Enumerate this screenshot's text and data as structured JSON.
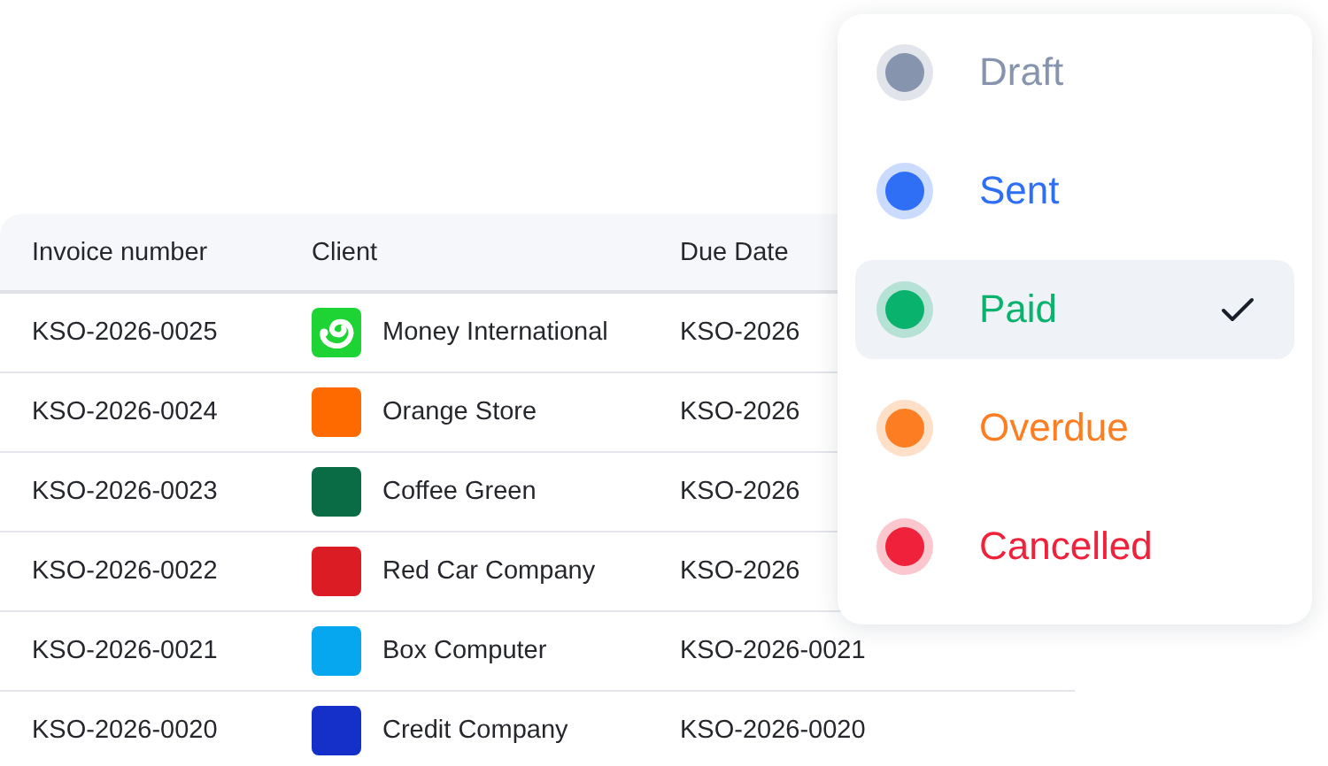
{
  "table": {
    "columns": [
      "Invoice number",
      "Client",
      "Due Date"
    ],
    "rows": [
      {
        "invoice": "KSO-2026-0025",
        "client": "Money International",
        "kind": "logo",
        "color": "#1ed334",
        "due": "KSO-2026"
      },
      {
        "invoice": "KSO-2026-0024",
        "client": "Orange Store",
        "kind": "swatch",
        "color": "#ff6a00",
        "due": "KSO-2026"
      },
      {
        "invoice": "KSO-2026-0023",
        "client": "Coffee Green",
        "kind": "swatch",
        "color": "#0a6c45",
        "due": "KSO-2026"
      },
      {
        "invoice": "KSO-2026-0022",
        "client": "Red Car Company",
        "kind": "swatch",
        "color": "#dc1c24",
        "due": "KSO-2026"
      },
      {
        "invoice": "KSO-2026-0021",
        "client": "Box Computer",
        "kind": "swatch",
        "color": "#06a7ef",
        "due": "KSO-2026-0021"
      },
      {
        "invoice": "KSO-2026-0020",
        "client": "Credit Company",
        "kind": "swatch",
        "color": "#1530c8",
        "due": "KSO-2026-0020"
      }
    ]
  },
  "status_menu": {
    "items": [
      {
        "label": "Draft",
        "color": "#8695ad",
        "selected": false
      },
      {
        "label": "Sent",
        "color": "#2f6ff6",
        "selected": false
      },
      {
        "label": "Paid",
        "color": "#09b36d",
        "selected": true
      },
      {
        "label": "Overdue",
        "color": "#fd7e22",
        "selected": false
      },
      {
        "label": "Cancelled",
        "color": "#f0213a",
        "selected": false
      }
    ]
  }
}
